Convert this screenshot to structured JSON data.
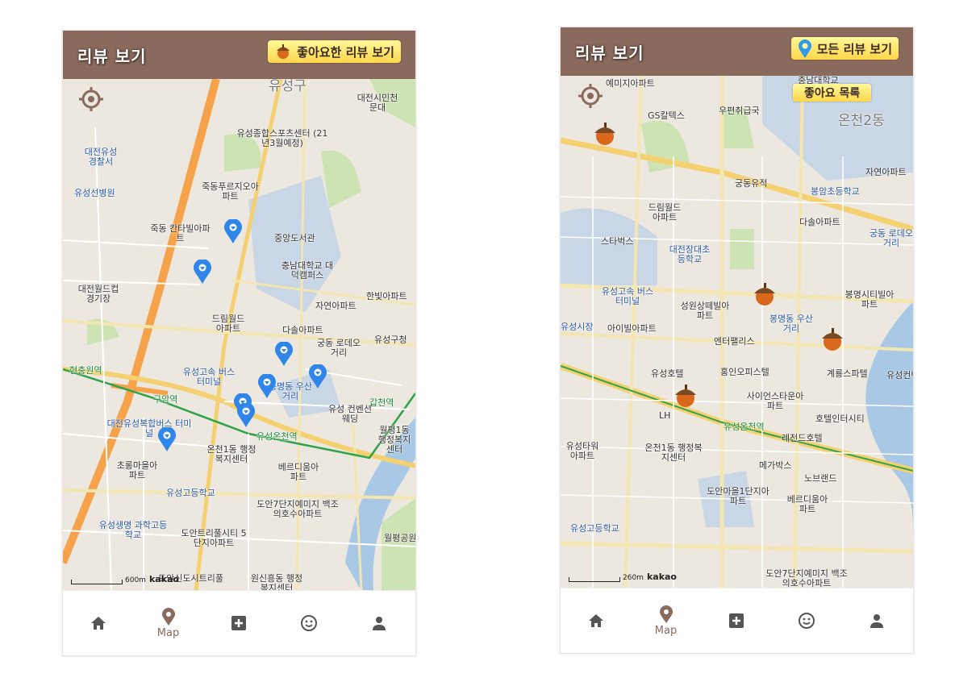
{
  "left": {
    "header_title": "리뷰 보기",
    "header_button": "좋아요한 리뷰 보기",
    "scale_label": "600m",
    "scale_brand": "kakao",
    "map_labels": [
      "유성구",
      "대전시민천문대",
      "대전유성경찰서",
      "유성선병원",
      "유성종합스포츠센터 (21년3월예정)",
      "죽동푸르지오아파트",
      "죽동 칸타빌아파트",
      "중앙도서관",
      "충남대학교 대덕캠퍼스",
      "대전월드컵경기장",
      "드림월드아파트",
      "자연아파트",
      "한빛아파트",
      "다솔아파트",
      "유성구청",
      "궁동 로데오거리",
      "유성고속 버스터미널",
      "봉명동 우산거리",
      "현충원역",
      "구암역",
      "대전유성복합버스 터미널",
      "유성온천역",
      "유성 컨벤션웨딩",
      "갑천역",
      "월평1동 행정복지센터",
      "온천1동 행정복지센터",
      "초롱마을아파트",
      "베르디움아파트",
      "유성고등학교",
      "유성생명 과학고등학교",
      "도안7단지예미지 백조의호수아파트",
      "도안트리풀시티 5단지아파트",
      "원신흥동 행정복지센터",
      "월평공원",
      "도안신도시트리풀"
    ]
  },
  "right": {
    "header_title": "리뷰 보기",
    "header_button": "모든 리뷰 보기",
    "like_list_button": "좋아요 목록",
    "scale_label": "260m",
    "scale_brand": "kakao",
    "map_labels": [
      "예미지아파트",
      "충남대학교",
      "GS칼텍스",
      "우편취급국",
      "온천2동",
      "궁동유적",
      "자연아파트",
      "봉암초등학교",
      "드림월드아파트",
      "다솔아파트",
      "궁동 로데오거리",
      "스타벅스",
      "대전장대초등학교",
      "유성고속 버스터미널",
      "성원상떼빌아파트",
      "봉명시티빌아파트",
      "유성시장",
      "아이빌아파트",
      "봉명동 우산거리",
      "엔터팰리스",
      "유성호텔",
      "홍인오피스텔",
      "계룡스파텔",
      "사이언스타운아파트",
      "호텔인터시티",
      "유성온천역",
      "레전드호텔",
      "온천1동 행정복지센터",
      "유성타워아파트",
      "메가박스",
      "노브랜드",
      "도안마을1단지아파트",
      "베르디움아파트",
      "유성고등학교",
      "도안7단지예미지 백조의호수아파트",
      "유성컨벤션",
      "LH"
    ]
  },
  "tabs": [
    {
      "icon": "home-icon",
      "label": ""
    },
    {
      "icon": "map-pin-icon",
      "label": "Map"
    },
    {
      "icon": "add-square-icon",
      "label": ""
    },
    {
      "icon": "smiley-icon",
      "label": ""
    },
    {
      "icon": "person-icon",
      "label": ""
    }
  ],
  "colors": {
    "header": "#8a6a5c",
    "button": "#ffe46a",
    "pin": "#2f86e8",
    "acorn": "#d9681c",
    "tab_active": "#8a6a5c",
    "tab_icon": "#555555"
  }
}
